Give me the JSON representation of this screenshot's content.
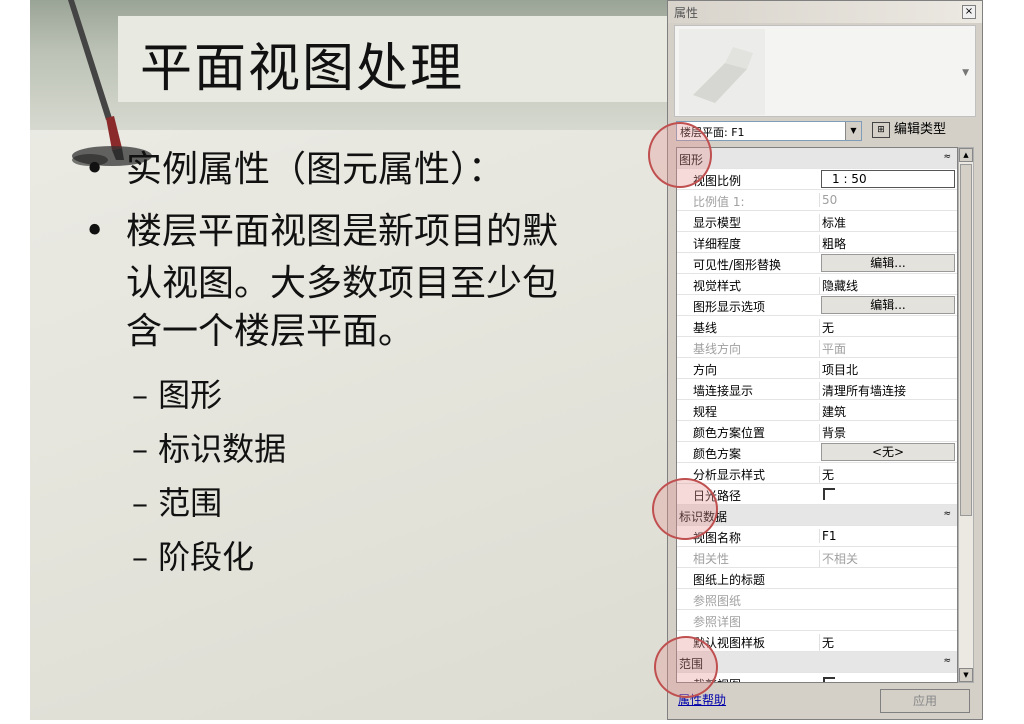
{
  "slide": {
    "title": "平面视图处理",
    "bullets": [
      "实例属性（图元属性）：",
      "楼层平面视图是新项目的默",
      "认视图。大多数项目至少包",
      "含一个楼层平面。"
    ],
    "bullet_marker": "•",
    "sub_items": [
      "– 图形",
      "– 标识数据",
      "– 范围",
      "– 阶段化"
    ]
  },
  "panel": {
    "title": "属性",
    "close_glyph": "×",
    "type_selector_value": "楼层平面: F1",
    "edit_type_label": "编辑类型",
    "groups": {
      "graphics": {
        "label": "图形",
        "rows": [
          {
            "key": "视图比例",
            "value": "1 : 50"
          },
          {
            "key": "比例值 1:",
            "value": "50"
          },
          {
            "key": "显示模型",
            "value": "标准"
          },
          {
            "key": "详细程度",
            "value": "粗略"
          },
          {
            "key": "可见性/图形替换",
            "value": "编辑..."
          },
          {
            "key": "视觉样式",
            "value": "隐藏线"
          },
          {
            "key": "图形显示选项",
            "value": "编辑..."
          },
          {
            "key": "基线",
            "value": "无"
          },
          {
            "key": "基线方向",
            "value": "平面"
          },
          {
            "key": "方向",
            "value": "项目北"
          },
          {
            "key": "墙连接显示",
            "value": "清理所有墙连接"
          },
          {
            "key": "规程",
            "value": "建筑"
          },
          {
            "key": "颜色方案位置",
            "value": "背景"
          },
          {
            "key": "颜色方案",
            "value": "<无>"
          },
          {
            "key": "分析显示样式",
            "value": "无"
          },
          {
            "key": "日光路径",
            "value": ""
          }
        ]
      },
      "identity": {
        "label": "标识数据",
        "rows": [
          {
            "key": "视图名称",
            "value": "F1"
          },
          {
            "key": "相关性",
            "value": "不相关"
          },
          {
            "key": "图纸上的标题",
            "value": ""
          },
          {
            "key": "参照图纸",
            "value": ""
          },
          {
            "key": "参照详图",
            "value": ""
          },
          {
            "key": "默认视图样板",
            "value": "无"
          }
        ]
      },
      "extents": {
        "label": "范围",
        "rows": [
          {
            "key": "裁剪视图",
            "value": ""
          }
        ]
      }
    },
    "collapse_glyph": "≈",
    "help_link": "属性帮助",
    "apply_button": "应用"
  }
}
